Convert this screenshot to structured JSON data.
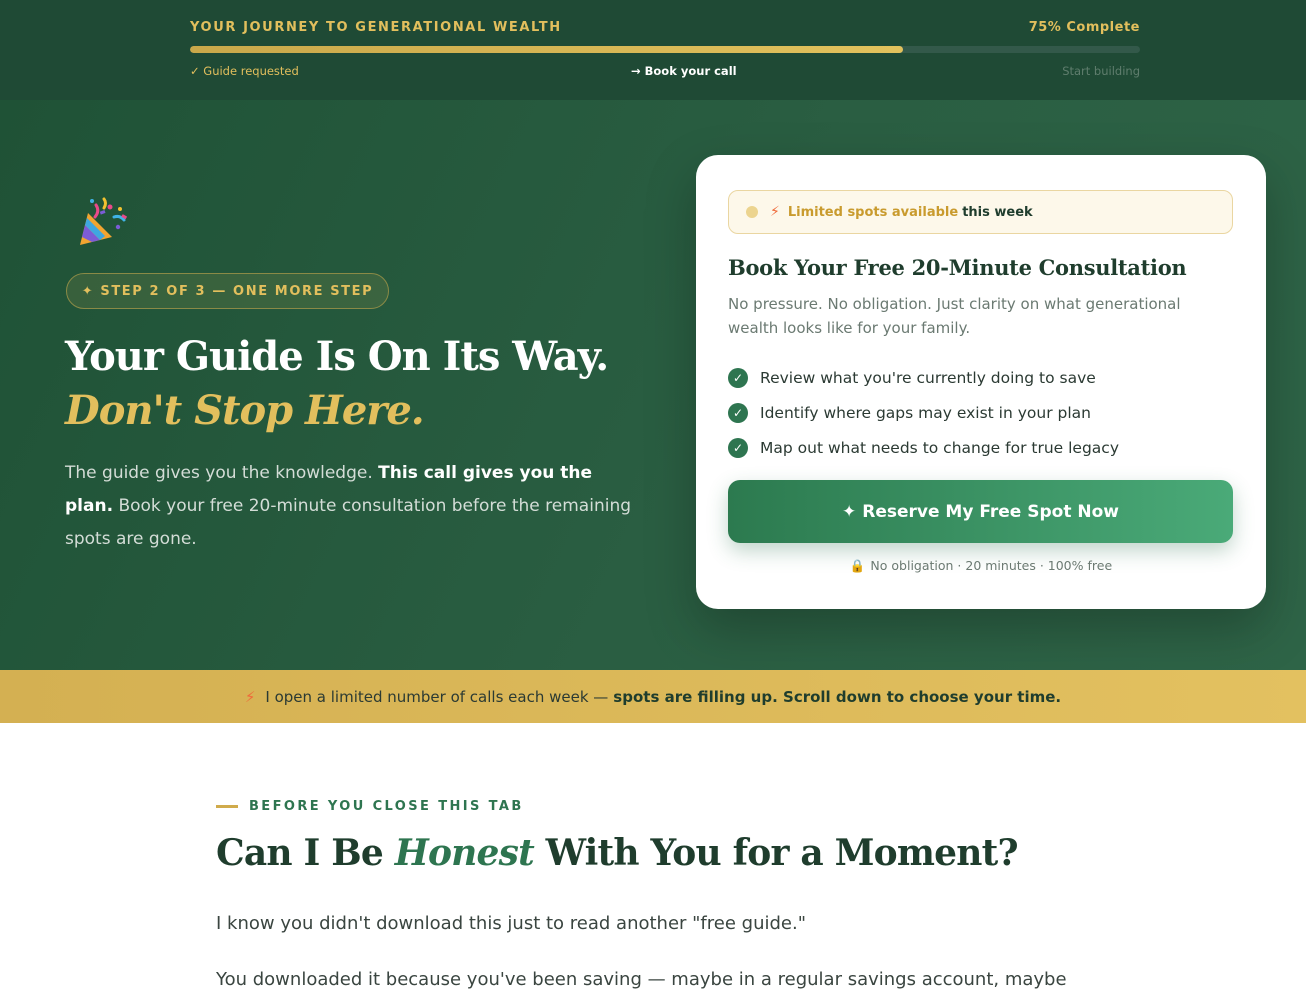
{
  "progress": {
    "title": "YOUR JOURNEY TO GENERATIONAL WEALTH",
    "percent_label": "75% Complete",
    "percent": 75,
    "steps": [
      {
        "label": "✓ Guide requested",
        "state": "done"
      },
      {
        "label": "→ Book your call",
        "state": "current"
      },
      {
        "label": "Start building",
        "state": "upcoming"
      }
    ]
  },
  "hero": {
    "icon": "party-popper-icon",
    "step_pill": "✦ STEP 2 OF 3 — ONE MORE STEP",
    "headline_line1": "Your Guide Is On Its Way.",
    "headline_line2": "Don't Stop Here.",
    "body_part1": "The guide gives you the knowledge.",
    "body_strong": "This call gives you the plan.",
    "body_part2": "Book your free 20-minute consultation before the remaining spots are gone."
  },
  "card": {
    "limited_highlight": "Limited spots available",
    "limited_suffix": "this week",
    "title": "Book Your Free 20-Minute Consultation",
    "subtitle": "No pressure. No obligation. Just clarity on what generational wealth looks like for your family.",
    "bullets": [
      "Review what you're currently doing to save",
      "Identify where gaps may exist in your plan",
      "Map out what needs to change for true legacy"
    ],
    "cta_label": "Reserve My Free Spot Now",
    "trust_line": "No obligation · 20 minutes · 100% free"
  },
  "banner": {
    "text": "I open a limited number of calls each week —",
    "strong": "spots are filling up. Scroll down to choose your time."
  },
  "section": {
    "eyebrow": "BEFORE YOU CLOSE THIS TAB",
    "heading_pre": "Can I Be",
    "heading_em": "Honest",
    "heading_post": "With You for a Moment?",
    "paragraph1": "I know you didn't download this just to read another \"free guide.\"",
    "paragraph2": "You downloaded it because you've been saving — maybe in a regular savings account, maybe"
  },
  "colors": {
    "dark_green": "#1f4a35",
    "gold": "#e2bf5d",
    "accent_green": "#2e7550"
  }
}
